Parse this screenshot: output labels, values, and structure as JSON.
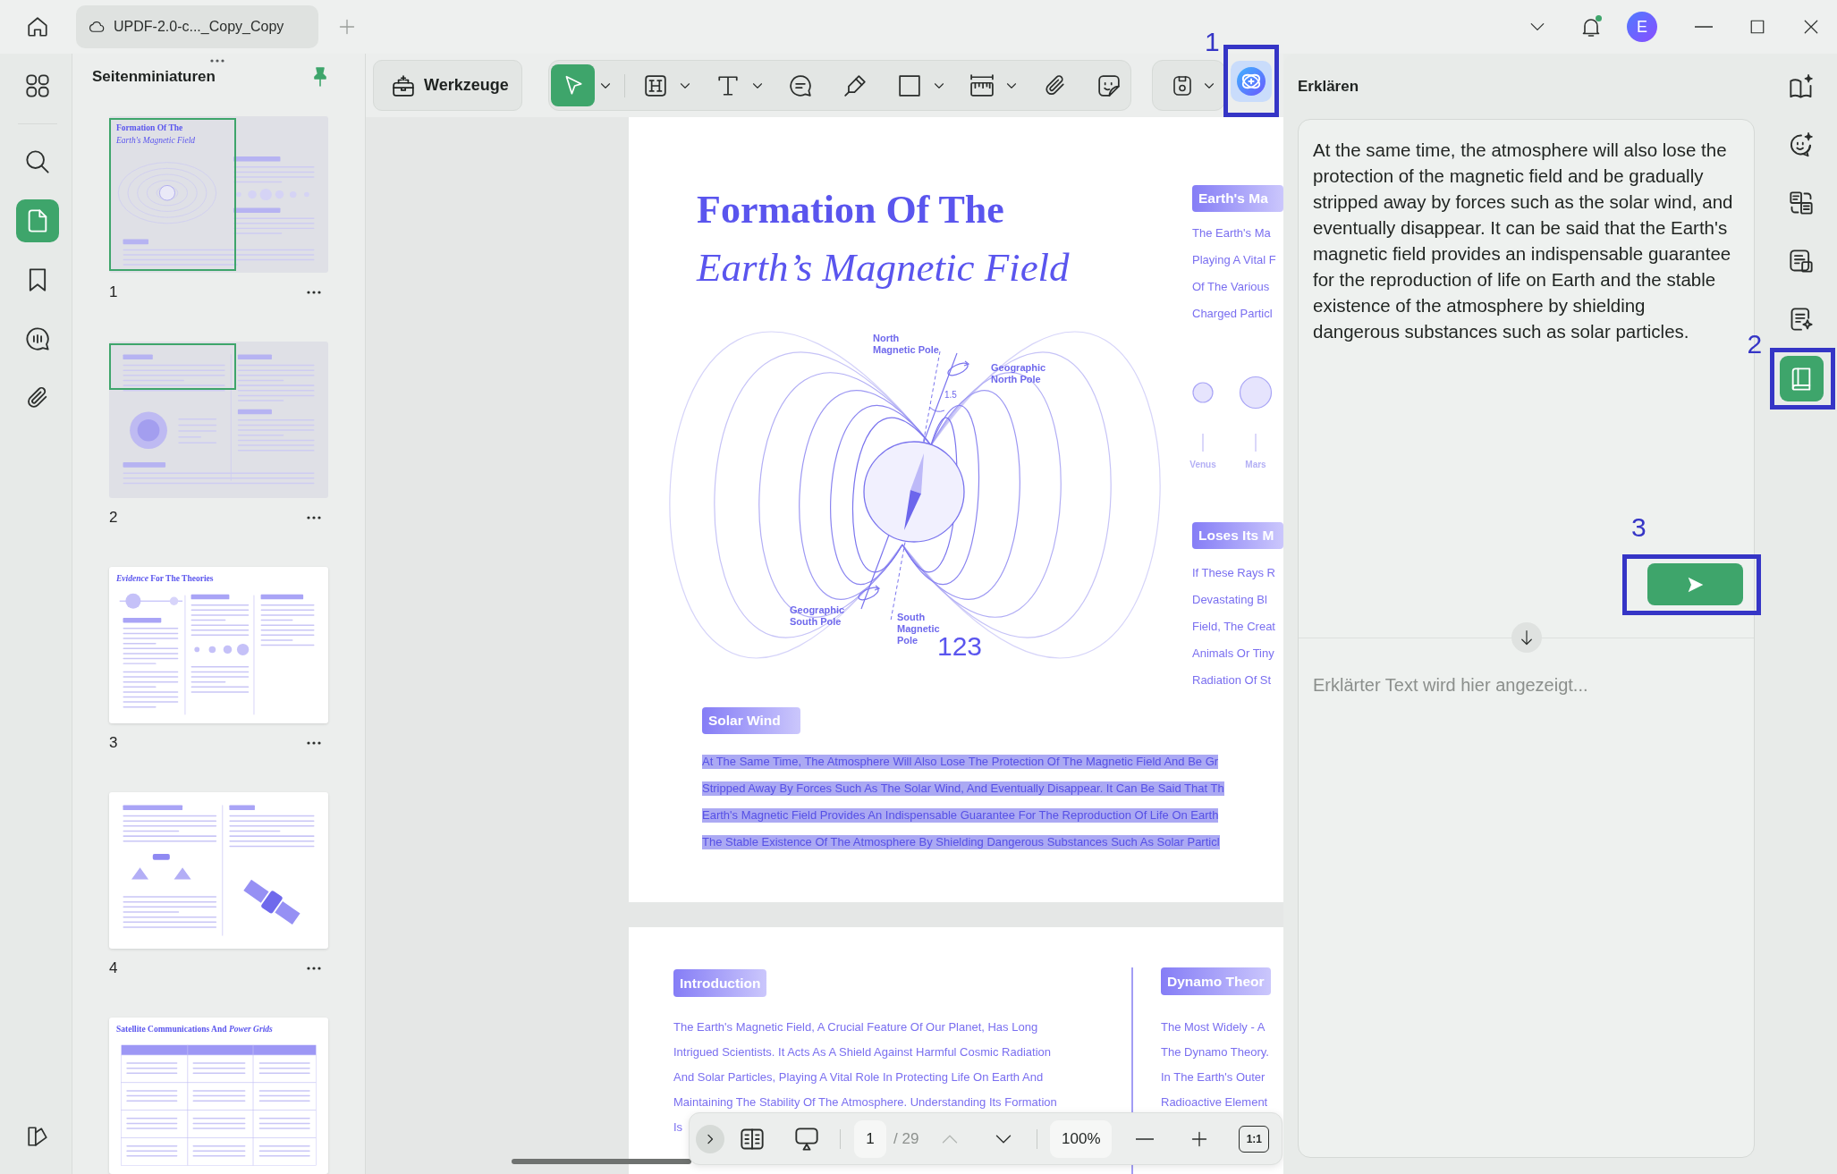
{
  "title_bar": {
    "tab": {
      "label": "UPDF-2.0-c..._Copy_Copy"
    },
    "notifications_unread": true,
    "avatar": "E"
  },
  "left_rail": {
    "items": [
      {
        "kind": "grid",
        "selected": false
      },
      {
        "kind": "search",
        "selected": false
      },
      {
        "kind": "pages",
        "selected": true
      },
      {
        "kind": "bookmarks",
        "selected": false
      },
      {
        "kind": "comments",
        "selected": false
      },
      {
        "kind": "attachments",
        "selected": false
      }
    ]
  },
  "thumbnail_panel": {
    "title": "Seitenminiaturen",
    "pinned": true,
    "pages": [
      {
        "kind": "cover",
        "title": "Formation Of The",
        "subtitle": "Earth's Magnetic Field",
        "number": "1",
        "in_view": true
      },
      {
        "kind": "text-diagram",
        "number": "2",
        "in_view": true
      },
      {
        "kind": "columns",
        "title": "*Evidence* For The Theories",
        "number": "3",
        "in_view": false
      },
      {
        "kind": "satellite",
        "number": "4",
        "in_view": false
      },
      {
        "kind": "table",
        "title": "Satellite Communications And *Power Grids*",
        "in_view": false
      }
    ]
  },
  "toolbar": {
    "tools_button": "Werkzeuge",
    "tools": [
      {
        "kind": "select",
        "selected": true,
        "dropdown": true
      },
      {
        "kind": "heading",
        "selected": false,
        "dropdown": true
      },
      {
        "kind": "text",
        "selected": false,
        "dropdown": true
      },
      {
        "kind": "comment",
        "selected": false,
        "dropdown": false
      },
      {
        "kind": "highlighter",
        "selected": false,
        "dropdown": false
      },
      {
        "kind": "rectangle",
        "selected": false,
        "dropdown": true
      },
      {
        "kind": "measure",
        "selected": false,
        "dropdown": true
      },
      {
        "kind": "attachment",
        "selected": false,
        "dropdown": false
      },
      {
        "kind": "sticker",
        "selected": false,
        "dropdown": false
      }
    ],
    "save": {
      "dropdown": true
    },
    "ai_button": {
      "callout": "1"
    }
  },
  "document": {
    "pages": [
      {
        "kind": "cover",
        "title": "Formation Of The",
        "subtitle": "Earth’s Magnetic Field",
        "diagram_labels": [
          "North Magnetic Pole",
          "Geographic North Pole",
          "1.5",
          "Geographic South Pole",
          "South Magnetic Pole"
        ],
        "page_mark": "123",
        "side_sections": [
          {
            "heading": "Earth's Ma",
            "lines": [
              "The Earth's Ma",
              "Playing A Vital F",
              "Of The Various",
              "Charged Particl"
            ],
            "planets": [
              "Venus",
              "Mars"
            ]
          },
          {
            "heading": "Loses Its M",
            "lines": [
              "If These Rays R",
              "Devastating Bl",
              "Field, The Creat",
              "Animals Or Tiny",
              "Radiation Of St"
            ]
          }
        ],
        "sections": [
          {
            "heading": "Solar Wind",
            "selected": true,
            "lines": [
              "At The Same Time, The Atmosphere Will Also Lose The Protection Of The Magnetic Field And Be Gr",
              "Stripped Away By Forces Such As The Solar Wind, And Eventually Disappear. It Can Be Said That Th",
              "Earth's Magnetic Field Provides An Indispensable Guarantee For The Reproduction Of Life On Earth",
              "The Stable Existence Of The Atmosphere By Shielding Dangerous Substances Such As Solar Particl"
            ]
          }
        ]
      },
      {
        "kind": "intro",
        "sections": [
          {
            "heading": "Introduction",
            "selected": false,
            "lines": [
              "The Earth's Magnetic Field, A Crucial Feature Of Our Planet, Has Long",
              "Intrigued Scientists. It Acts As A Shield Against Harmful Cosmic Radiation",
              "And Solar Particles, Playing A Vital Role In Protecting Life On Earth And",
              "Maintaining The Stability Of The Atmosphere. Understanding Its Formation",
              "Is"
            ]
          },
          {
            "heading": "Dynamo Theor",
            "selected": false,
            "lines": [
              "The Most Widely - A",
              "The Dynamo Theory.",
              "In The Earth's Outer",
              "Radioactive Element"
            ]
          }
        ]
      }
    ]
  },
  "page_bar": {
    "page": "1",
    "total": "/ 29",
    "previous_disabled": true,
    "zoom": "100%",
    "actual_size": "1:1"
  },
  "explain_panel": {
    "title": "Erklären",
    "source_text": "At the same time, the atmosphere will also lose the protection of the magnetic field and be gradually stripped away by forces such as the solar wind, and eventually disappear. It can be said that the Earth's magnetic field provides an indispensable guarantee for the reproduction of life on Earth and the stable existence of the atmosphere by shielding dangerous substances such as solar particles.",
    "send_button": {
      "callout": "3"
    },
    "output": {
      "placeholder": "Erklärter Text wird hier angezeigt..."
    },
    "tools": [
      {
        "kind": "reader",
        "selected": false
      },
      {
        "kind": "chat",
        "selected": false
      },
      {
        "kind": "translate",
        "selected": false
      },
      {
        "kind": "translate-box",
        "selected": false
      },
      {
        "kind": "summarize",
        "selected": false
      },
      {
        "kind": "explain",
        "selected": true,
        "callout": "2"
      }
    ]
  }
}
